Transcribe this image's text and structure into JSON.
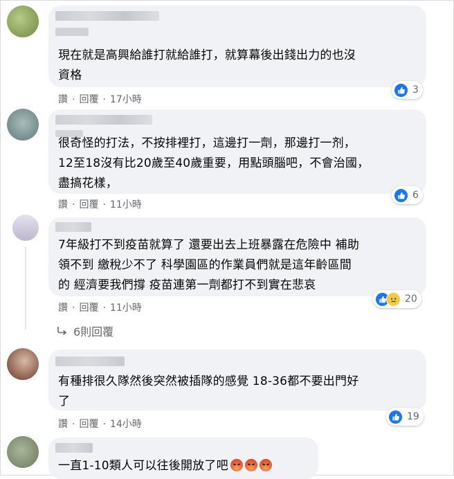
{
  "comments": [
    {
      "text_lines": [
        "現在就是高興給誰打就給誰打，就算幕後出錢出力的也沒",
        "資格"
      ],
      "actions": {
        "read": "讚",
        "reply": "回覆",
        "time": "17小時"
      },
      "reaction_count": "3",
      "avatar_color": "#8aa35a"
    },
    {
      "text_lines": [
        "很奇怪的打法，不按排裡打，這邊打一劑，那邊打一剂，",
        "12至18沒有比20歲至40歲重要，用點頭腦吧，不會治國，",
        "盡搞花樣，"
      ],
      "actions": {
        "read": "讚",
        "reply": "回覆",
        "time": "11小時"
      },
      "reaction_count": "6",
      "avatar_color": "#6f8c8a"
    },
    {
      "text_lines": [
        "7年級打不到疫苗就算了 還要出去上班暴露在危險中 補助",
        "領不到 繳稅少不了 科學園區的作業員們就是這年齡區間",
        "的 經濟要我們撐 疫苗連第一劑都打不到實在悲哀"
      ],
      "actions": {
        "read": "讚",
        "reply": "回覆",
        "time": "11小時"
      },
      "reaction_count": "20",
      "replies_label": "6則回覆",
      "avatar_color": "#c9c3d6"
    },
    {
      "text_lines": [
        "有種排很久隊然後突然被插隊的感覺 18-36都不要出門好",
        "了"
      ],
      "actions": {
        "read": "讚",
        "reply": "回覆",
        "time": "14小時"
      },
      "reaction_count": "19",
      "avatar_color": "#9b7b6a"
    },
    {
      "text_lines": [
        "一直1-10類人可以往後開放了吧"
      ],
      "avatar_color": "#7d8a70"
    }
  ],
  "colors": {
    "like": "#1877f2",
    "bubble": "#f0f2f5",
    "meta": "#65676b"
  }
}
